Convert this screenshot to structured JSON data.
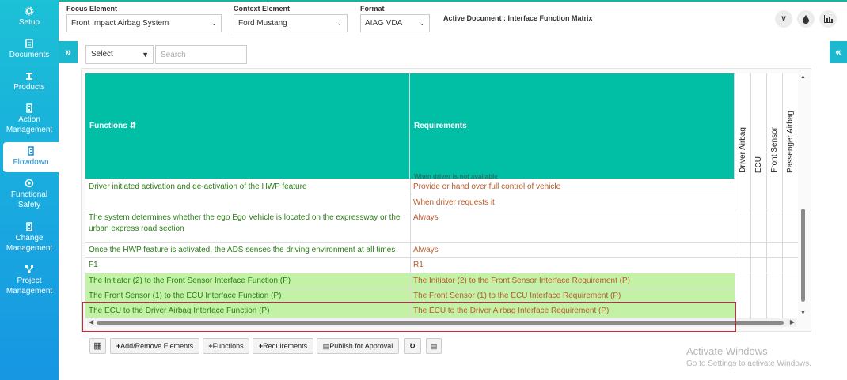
{
  "sidebar": {
    "items": [
      {
        "label": "Setup",
        "icon": "gear-icon"
      },
      {
        "label": "Documents",
        "icon": "document-icon"
      },
      {
        "label": "Products",
        "icon": "products-icon"
      },
      {
        "label": "Action Management",
        "icon": "building-icon"
      },
      {
        "label": "Flowdown",
        "icon": "flowdown-icon"
      },
      {
        "label": "Functional Safety",
        "icon": "safety-icon"
      },
      {
        "label": "Change Management",
        "icon": "building-icon"
      },
      {
        "label": "Project Management",
        "icon": "network-icon"
      }
    ],
    "active": "Flowdown"
  },
  "header": {
    "focus_label": "Focus Element",
    "focus_value": "Front Impact Airbag System",
    "context_label": "Context Element",
    "context_value": "Ford Mustang",
    "format_label": "Format",
    "format_value": "AIAG VDA",
    "active_document": "Active Document : Interface Function Matrix",
    "icons": [
      "v-icon",
      "drop-icon",
      "chart-icon"
    ]
  },
  "filter": {
    "select_value": "Select",
    "search_placeholder": "Search"
  },
  "matrix": {
    "functions_header": "Functions",
    "requirements_header": "Requirements",
    "columns": [
      "Driver Airbag",
      "ECU",
      "Front Sensor",
      "Passenger Airbag"
    ],
    "partial_top_row": {
      "function": "....................................",
      "requirement": "........"
    },
    "partial_req_peek": "When driver is not available",
    "rows": [
      {
        "function": "Driver initiated activation and de-activation of the HWP feature",
        "requirements": [
          "Provide or hand over full control of vehicle",
          "When driver requests it"
        ],
        "highlight": false
      },
      {
        "function": "The system determines whether the ego Ego Vehicle is located on the expressway or the urban express road section",
        "requirements": [
          "Always"
        ],
        "highlight": false
      },
      {
        "function": "Once the HWP feature is activated, the ADS senses the driving environment at all times",
        "requirements": [
          "Always"
        ],
        "highlight": false
      },
      {
        "function": "F1",
        "requirements": [
          "R1"
        ],
        "highlight": false
      },
      {
        "function": "The Initiator (2) to the Front Sensor Interface Function (P)",
        "requirements": [
          "The Initiator (2) to the Front Sensor Interface Requirement (P)"
        ],
        "highlight": true
      },
      {
        "function": "The Front Sensor (1) to the ECU Interface Function (P)",
        "requirements": [
          "The Front Sensor (1) to the ECU Interface Requirement (P)"
        ],
        "highlight": true
      },
      {
        "function": "The ECU to the Driver Airbag Interface Function (P)",
        "requirements": [
          "The ECU to the Driver Airbag Interface Requirement (P)"
        ],
        "highlight": true
      }
    ]
  },
  "toolbar": {
    "add_remove": "Add/Remove Elements",
    "functions": "Functions",
    "requirements": "Requirements",
    "publish": "Publish for Approval"
  },
  "watermark": {
    "line1": "Activate Windows",
    "line2": "Go to Settings to activate Windows."
  },
  "colors": {
    "teal_header": "#00bfa5",
    "green_row": "#c3f1a6",
    "function_text": "#2a7d16",
    "requirement_text": "#b85a2a",
    "highlight_border": "#d6242b"
  }
}
